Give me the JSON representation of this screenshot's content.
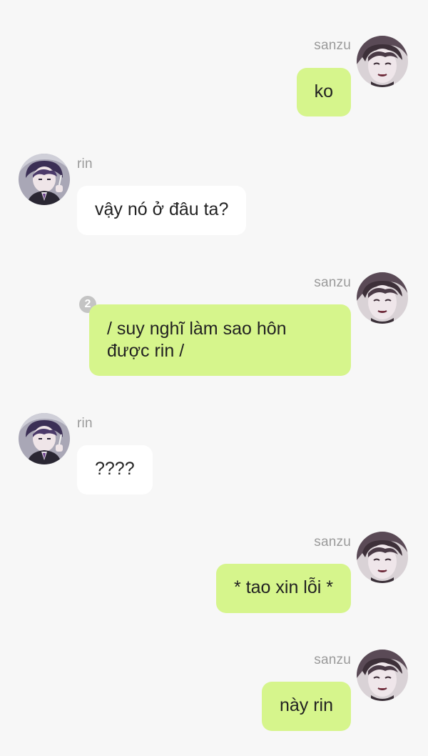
{
  "messages": [
    {
      "sender": "sanzu",
      "text": "ko"
    },
    {
      "sender": "rin",
      "text": "vậy nó ở đâu ta?"
    },
    {
      "sender": "sanzu",
      "text": "/ suy nghĩ làm sao hôn\nđược rin /",
      "badge": "2"
    },
    {
      "sender": "rin",
      "text": "????"
    },
    {
      "sender": "sanzu",
      "text": "* tao xin lỗi *"
    },
    {
      "sender": "sanzu",
      "text": "này rin"
    }
  ],
  "avatars": {
    "sanzu": "sanzu-avatar-icon",
    "rin": "rin-avatar-icon"
  },
  "colors": {
    "background": "#f7f7f7",
    "outgoing_bubble": "#d6f58c",
    "incoming_bubble": "#ffffff",
    "name_text": "#9a9a9a",
    "badge": "#c4c4c4"
  }
}
